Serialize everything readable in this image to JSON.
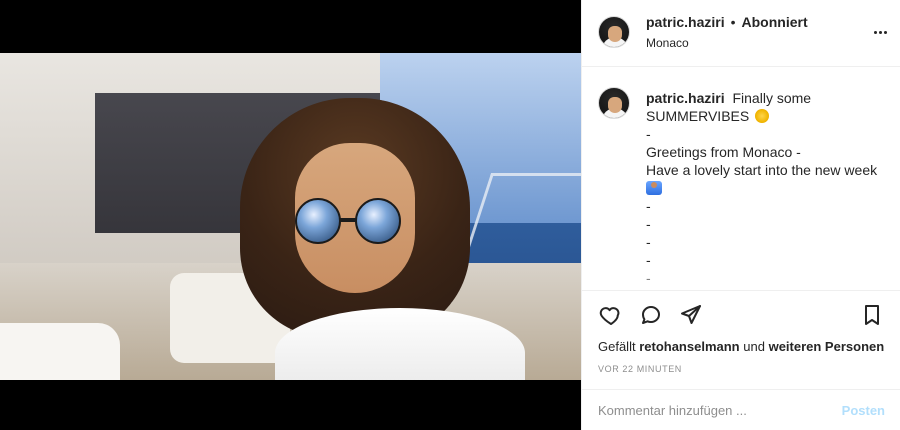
{
  "post": {
    "username": "patric.haziri",
    "dot": "•",
    "follow_status": "Abonniert",
    "location": "Monaco"
  },
  "caption": {
    "username": "patric.haziri",
    "lines": [
      "Finally some",
      "SUMMERVIBES",
      "-",
      "Greetings from Monaco -",
      "Have a lovely start into the new week",
      "",
      "-",
      "-",
      "-",
      "-",
      "-"
    ]
  },
  "likes": {
    "prefix": "Gefällt",
    "user": "retohanselmann",
    "middle": "und",
    "suffix": "weiteren Personen"
  },
  "timestamp": "VOR 22 MINUTEN",
  "comment_box": {
    "placeholder": "Kommentar hinzufügen ...",
    "post_label": "Posten"
  },
  "icons": {
    "more": "more-options-icon",
    "like": "heart-icon",
    "comment": "comment-icon",
    "share": "share-icon",
    "save": "bookmark-icon"
  },
  "colors": {
    "text": "#262626",
    "muted": "#8e8e8e",
    "border": "#efefef",
    "post_disabled": "#b2dffc"
  }
}
